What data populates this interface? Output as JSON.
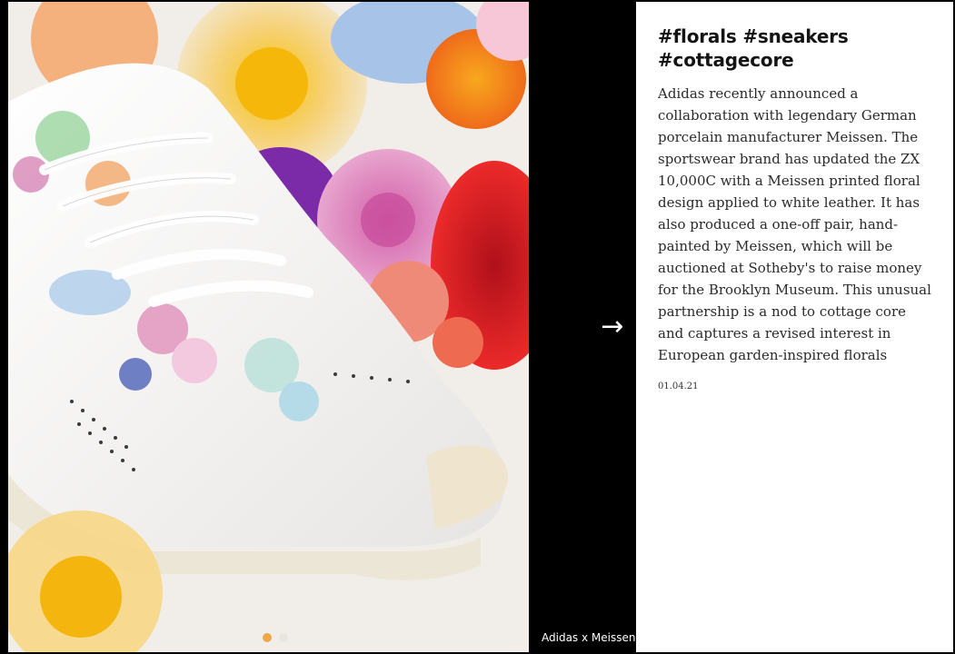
{
  "slideshow": {
    "image_alt": "Adidas ZX 10,000C sneaker with Meissen floral print surrounded by flowers",
    "slide_count": 2,
    "active_slide": 1,
    "caption": "Adidas x Meissen",
    "next_arrow": "→"
  },
  "article": {
    "tags": "#florals #sneakers #cottagecore",
    "body": "Adidas recently announced a collaboration with legendary German porcelain manufacturer Meissen. The sportswear brand has updated the ZX 10,000C with a Meissen printed floral design applied to white leather. It has also produced a one-off pair, hand-painted by Meissen, which will be auctioned at Sotheby's to raise money for the Brooklyn Museum. This unusual partnership is a nod to cottage core and captures a revised interest in European garden-inspired florals",
    "date": "01.04.21"
  },
  "colors": {
    "background": "#000000",
    "panel": "#ffffff",
    "dot_active": "#efa847",
    "dot_inactive": "#e9e4dc"
  }
}
